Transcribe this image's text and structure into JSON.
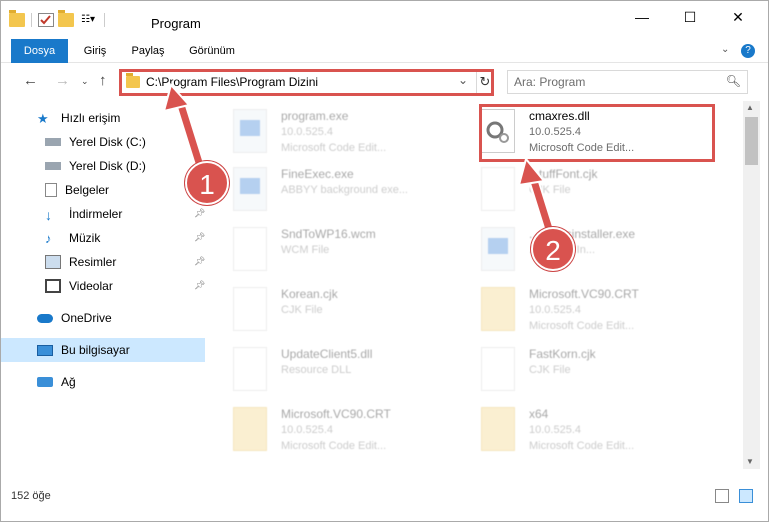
{
  "window": {
    "title": "Program",
    "controls": {
      "minimize": "—",
      "maximize": "☐",
      "close": "✕"
    }
  },
  "ribbon": {
    "tabs": [
      "Dosya",
      "Giriş",
      "Paylaş",
      "Görünüm"
    ],
    "expand_icon": "chevron-down-icon",
    "help_icon": "help-icon"
  },
  "address": {
    "path": "C:\\Program Files\\Program Dizini",
    "search_placeholder": "Ara: Program"
  },
  "sidebar": {
    "items": [
      {
        "label": "Hızlı erişim",
        "icon": "star-icon",
        "pinned": false
      },
      {
        "label": "Yerel Disk (C:)",
        "icon": "drive-icon",
        "pinned": false
      },
      {
        "label": "Yerel Disk (D:)",
        "icon": "drive-icon",
        "pinned": false
      },
      {
        "label": "Belgeler",
        "icon": "documents-icon",
        "pinned": false
      },
      {
        "label": "İndirmeler",
        "icon": "download-icon",
        "pinned": true
      },
      {
        "label": "Müzik",
        "icon": "music-icon",
        "pinned": true
      },
      {
        "label": "Resimler",
        "icon": "pictures-icon",
        "pinned": true
      },
      {
        "label": "Videolar",
        "icon": "video-icon",
        "pinned": true
      },
      {
        "label": "OneDrive",
        "icon": "cloud-icon",
        "pinned": false
      },
      {
        "label": "Bu bilgisayar",
        "icon": "computer-icon",
        "pinned": false,
        "selected": true
      },
      {
        "label": "Ağ",
        "icon": "network-icon",
        "pinned": false
      }
    ]
  },
  "files": [
    {
      "name": "program.exe",
      "meta1": "10.0.525.4",
      "meta2": "Microsoft Code Edit...",
      "kind": "exe",
      "faded": true
    },
    {
      "name": "cmaxres.dll",
      "meta1": "10.0.525.4",
      "meta2": "Microsoft Code Edit...",
      "kind": "dll",
      "faded": false
    },
    {
      "name": "FineExec.exe",
      "meta1": "ABBYY background exe...",
      "meta2": "",
      "kind": "exe",
      "faded": true
    },
    {
      "name": "...tuffFont.cjk",
      "meta1": "CJK File",
      "meta2": "",
      "kind": "file",
      "faded": true
    },
    {
      "name": "SndToWP16.wcm",
      "meta1": "WCM File",
      "meta2": "",
      "kind": "file",
      "faded": true
    },
    {
      "name": "...ommsinstaller.exe",
      "meta1": "...nstaller In...",
      "meta2": "",
      "kind": "exe",
      "faded": true
    },
    {
      "name": "Korean.cjk",
      "meta1": "CJK File",
      "meta2": "",
      "kind": "file",
      "faded": true
    },
    {
      "name": "Microsoft.VC90.CRT",
      "meta1": "10.0.525.4",
      "meta2": "Microsoft Code Edit...",
      "kind": "folder",
      "faded": true
    },
    {
      "name": "UpdateClient5.dll",
      "meta1": "Resource DLL",
      "meta2": "",
      "kind": "file",
      "faded": true
    },
    {
      "name": "FastKorn.cjk",
      "meta1": "CJK File",
      "meta2": "",
      "kind": "file",
      "faded": true
    },
    {
      "name": "Microsoft.VC90.CRT",
      "meta1": "10.0.525.4",
      "meta2": "Microsoft Code Edit...",
      "kind": "folder",
      "faded": true
    },
    {
      "name": "x64",
      "meta1": "10.0.525.4",
      "meta2": "Microsoft Code Edit...",
      "kind": "folder",
      "faded": true
    }
  ],
  "status": {
    "count": "152 öğe"
  },
  "annotations": {
    "badge1": "1",
    "badge2": "2",
    "color": "#d9534f"
  }
}
